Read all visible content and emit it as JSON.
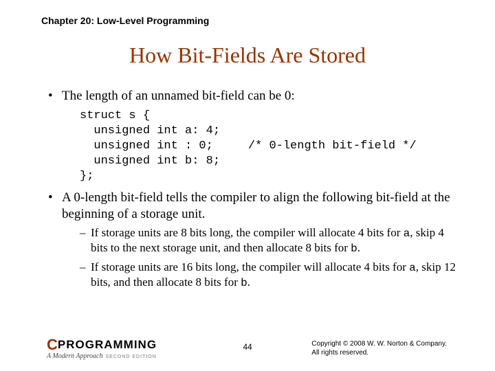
{
  "chapter": "Chapter 20: Low-Level Programming",
  "title": "How Bit-Fields Are Stored",
  "bullet1": "The length of an unnamed bit-field can be 0:",
  "code": "struct s {\n  unsigned int a: 4;\n  unsigned int : 0;     /* 0-length bit-field */\n  unsigned int b: 8;\n};",
  "bullet2": "A 0-length bit-field tells the compiler to align the following bit-field at the beginning of a storage unit.",
  "sub1_a": "If storage units are 8 bits long, the compiler will allocate 4 bits for ",
  "sub1_b": ", skip 4 bits to the next storage unit, and then allocate 8 bits for ",
  "sub1_c": ".",
  "sub2_a": "If storage units are 16 bits long, the compiler will allocate 4 bits for ",
  "sub2_b": ", skip 12 bits, and then allocate 8 bits for ",
  "sub2_c": ".",
  "var_a": "a",
  "var_b": "b",
  "logo_c": "C",
  "logo_prog": "PROGRAMMING",
  "logo_sub": "A Modern Approach",
  "logo_ed": "SECOND EDITION",
  "pagenum": "44",
  "copyright1": "Copyright © 2008 W. W. Norton & Company.",
  "copyright2": "All rights reserved."
}
